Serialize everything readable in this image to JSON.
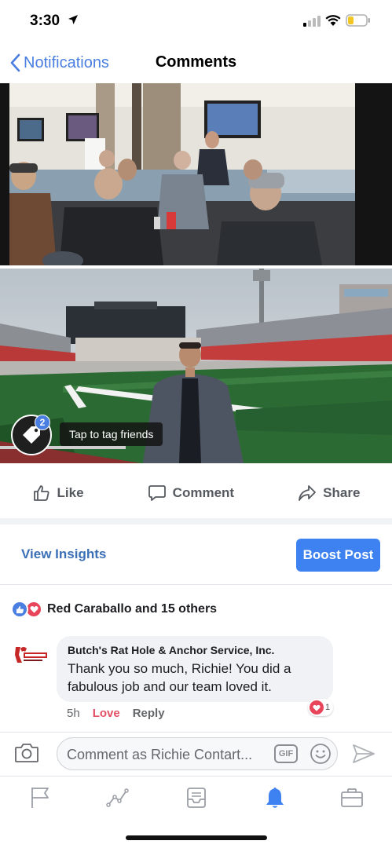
{
  "status_bar": {
    "time": "3:30"
  },
  "nav": {
    "back_label": "Notifications",
    "title": "Comments"
  },
  "photo_tag": {
    "count": "2",
    "tooltip": "Tap to tag friends"
  },
  "post_actions": {
    "like": "Like",
    "comment": "Comment",
    "share": "Share"
  },
  "insights": {
    "view_label": "View Insights",
    "boost_label": "Boost Post"
  },
  "reactions": {
    "summary": "Red Caraballo and 15 others"
  },
  "comment": {
    "author": "Butch's Rat Hole & Anchor Service, Inc.",
    "text": "Thank you so much, Richie! You did a fabulous job and our team loved it.",
    "time": "5h",
    "love_label": "Love",
    "reply_label": "Reply",
    "love_count": "1"
  },
  "composer": {
    "placeholder": "Comment as Richie Contart...",
    "gif_label": "GIF"
  },
  "tab_bar": {
    "tabs": [
      "flag-icon",
      "activity-icon",
      "inbox-icon",
      "notifications-icon",
      "tools-icon"
    ],
    "active": "notifications-icon"
  },
  "colors": {
    "accent": "#4a7ee0",
    "boost": "#3d82f0",
    "love": "#e8455a",
    "link": "#3b6fb6"
  }
}
